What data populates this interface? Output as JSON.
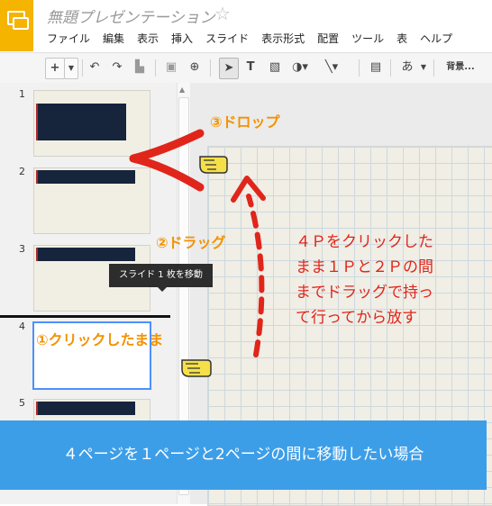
{
  "app": {
    "title": "無題プレゼンテーション",
    "star": "☆"
  },
  "menu": [
    "ファイル",
    "編集",
    "表示",
    "挿入",
    "スライド",
    "表示形式",
    "配置",
    "ツール",
    "表",
    "ヘルプ"
  ],
  "toolbar": {
    "add_label": "+",
    "text_label": "あ",
    "font_label": "背景..."
  },
  "slides": {
    "numbers": [
      "1",
      "2",
      "3",
      "4",
      "5"
    ]
  },
  "tooltip": "スライド 1 枚を移動",
  "annotations": {
    "drop": "③ドロップ",
    "drag": "②ドラッグ",
    "click": "①クリックしたまま",
    "note_lines": [
      "４Ｐをクリックした",
      "まま１Ｐと２Ｐの間",
      "までドラッグで持っ",
      "て行ってから放す"
    ]
  },
  "banner": "４ページを１ページと2ページの間に移動したい場合",
  "colors": {
    "banner": "#3d9ee8",
    "orange": "#f39200",
    "red": "#e0251b",
    "slide_block": "#16243c"
  }
}
